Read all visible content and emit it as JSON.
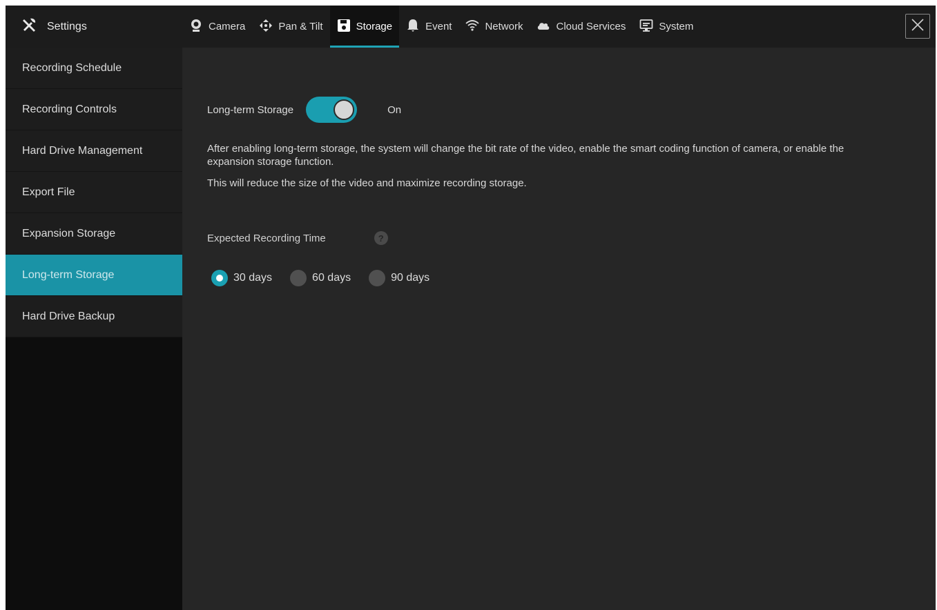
{
  "header": {
    "title": "Settings",
    "title_icon": "tools-icon",
    "tabs": [
      {
        "label": "Camera",
        "icon": "camera-icon"
      },
      {
        "label": "Pan & Tilt",
        "icon": "pan-tilt-icon"
      },
      {
        "label": "Storage",
        "icon": "floppy-icon",
        "active": true
      },
      {
        "label": "Event",
        "icon": "bell-icon"
      },
      {
        "label": "Network",
        "icon": "wifi-icon"
      },
      {
        "label": "Cloud Services",
        "icon": "cloud-icon"
      },
      {
        "label": "System",
        "icon": "monitor-icon"
      }
    ],
    "close_icon": "close-icon"
  },
  "sidebar": {
    "items": [
      {
        "label": "Recording Schedule"
      },
      {
        "label": "Recording Controls"
      },
      {
        "label": "Hard Drive Management"
      },
      {
        "label": "Export File"
      },
      {
        "label": "Expansion Storage"
      },
      {
        "label": "Long-term Storage",
        "active": true
      },
      {
        "label": "Hard Drive Backup"
      }
    ]
  },
  "main": {
    "toggle_label": "Long-term Storage",
    "toggle_state": "On",
    "toggle_on": true,
    "description_1": "After enabling long-term storage, the system will change the bit rate of the video, enable the smart coding function of camera, or enable the expansion storage function.",
    "description_2": "This will reduce the size of the video and maximize recording storage.",
    "expected_label": "Expected Recording Time",
    "help_icon": "?",
    "options": [
      {
        "label": "30 days",
        "checked": true
      },
      {
        "label": "60 days",
        "checked": false
      },
      {
        "label": "90 days",
        "checked": false
      }
    ]
  },
  "colors": {
    "accent": "#1a9eb0",
    "background": "#262626",
    "sidebar": "#1d1d1d",
    "topbar": "#1c1c1c"
  }
}
